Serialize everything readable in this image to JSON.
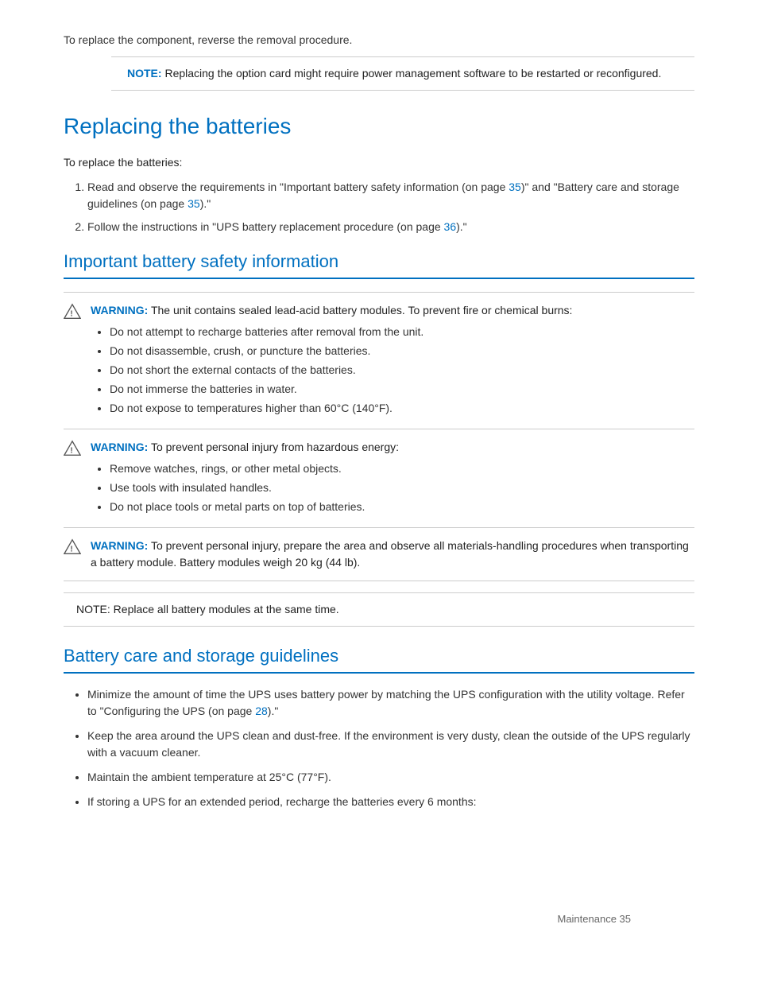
{
  "intro": {
    "text": "To replace the component, reverse the removal procedure.",
    "note_label": "NOTE:",
    "note_text": " Replacing the option card might require power management software to be restarted or reconfigured."
  },
  "replacing_batteries": {
    "title": "Replacing the batteries",
    "intro": "To replace the batteries:",
    "steps": [
      {
        "id": 1,
        "text_before": "Read and observe the requirements in \"Important battery safety information (on page ",
        "link1_text": "35",
        "text_mid": ")\" and \"Battery care and storage guidelines (on page ",
        "link2_text": "35",
        "text_after": ").\""
      },
      {
        "id": 2,
        "text_before": "Follow the instructions in \"UPS battery replacement procedure (on page ",
        "link_text": "36",
        "text_after": ").\""
      }
    ]
  },
  "important_battery_safety": {
    "title": "Important battery safety information",
    "warnings": [
      {
        "label": "WARNING:",
        "text": " The unit contains sealed lead-acid battery modules. To prevent fire or chemical burns:",
        "bullets": [
          "Do not attempt to recharge batteries after removal from the unit.",
          "Do not disassemble, crush, or puncture the batteries.",
          "Do not short the external contacts of the batteries.",
          "Do not immerse the batteries in water.",
          "Do not expose to temperatures higher than 60°C (140°F)."
        ]
      },
      {
        "label": "WARNING:",
        "text": " To prevent personal injury from hazardous energy:",
        "bullets": [
          "Remove watches, rings, or other metal objects.",
          "Use tools with insulated handles.",
          "Do not place tools or metal parts on top of batteries."
        ]
      },
      {
        "label": "WARNING:",
        "text": " To prevent personal injury, prepare the area and observe all materials-handling procedures when transporting a battery module. Battery modules weigh 20 kg (44 lb).",
        "bullets": []
      }
    ],
    "note_label": "NOTE:",
    "note_text": "  Replace all battery modules at the same time."
  },
  "battery_care": {
    "title": "Battery care and storage guidelines",
    "bullets": [
      {
        "text_before": "Minimize the amount of time the UPS uses battery power by matching the UPS configuration with the utility voltage. Refer to \"Configuring the UPS (on page ",
        "link_text": "28",
        "text_after": ").\""
      },
      {
        "text_before": "Keep the area around the UPS clean and dust-free. If the environment is very dusty, clean the outside of the UPS regularly with a vacuum cleaner.",
        "link_text": null,
        "text_after": null
      },
      {
        "text_before": "Maintain the ambient temperature at 25°C (77°F).",
        "link_text": null,
        "text_after": null
      },
      {
        "text_before": "If storing a UPS for an extended period, recharge the batteries every 6 months:",
        "link_text": null,
        "text_after": null
      }
    ]
  },
  "footer": {
    "text": "Maintenance  35"
  }
}
